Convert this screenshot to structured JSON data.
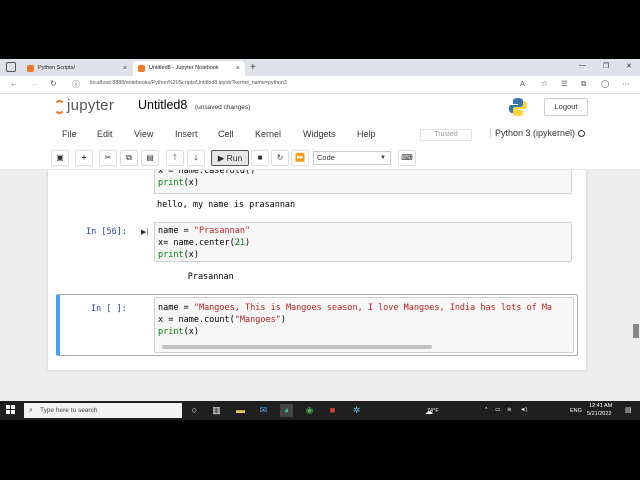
{
  "browser": {
    "tabs": [
      {
        "label": "Python Scripts/",
        "active": false,
        "icon_color": "#f37726"
      },
      {
        "label": "Untitled8 - Jupyter Notebook",
        "active": true,
        "icon_color": "#f37726"
      }
    ],
    "new_tab": "+",
    "url": "localhost:8888/notebooks/Python%20Scripts/Untitled8.ipynb?kernel_name=python3"
  },
  "jupyter": {
    "brand": "jupyter",
    "title": "Untitled8",
    "save_status": "(unsaved changes)",
    "logout_label": "Logout",
    "menus": [
      "File",
      "Edit",
      "View",
      "Insert",
      "Cell",
      "Kernel",
      "Widgets",
      "Help"
    ],
    "trusted_label": "Trusted",
    "kernel_label": "Python 3 (ipykernel)",
    "run_label": "Run",
    "cell_type": "Code"
  },
  "cells": [
    {
      "prompt": "",
      "code": [
        "x = name.casefold()",
        "print(x)"
      ],
      "output": "hello, my name is prasannan"
    },
    {
      "prompt": "In [56]:",
      "code": [
        "name = \"Prasannan\"",
        "x= name.center(21)",
        "print(x)"
      ],
      "output": "      Prasannan"
    },
    {
      "prompt": "In [ ]:",
      "code": [
        "name = \"Mangoes, This is Mangoes season, I love Mangoes, India has lots of Ma",
        "x = name.count(\"Mangoes\")",
        "print(x)"
      ],
      "output": ""
    }
  ],
  "taskbar": {
    "search_placeholder": "Type here to search",
    "weather": "74°F",
    "language": "ENG",
    "time": "12:41 AM",
    "date": "5/21/2022"
  },
  "colors": {
    "jupyter_orange": "#f37726",
    "prompt_blue": "#303f9f",
    "selected_cell_border": "#42a5f5",
    "string_red": "#ba2121",
    "builtin_green": "#008000"
  }
}
